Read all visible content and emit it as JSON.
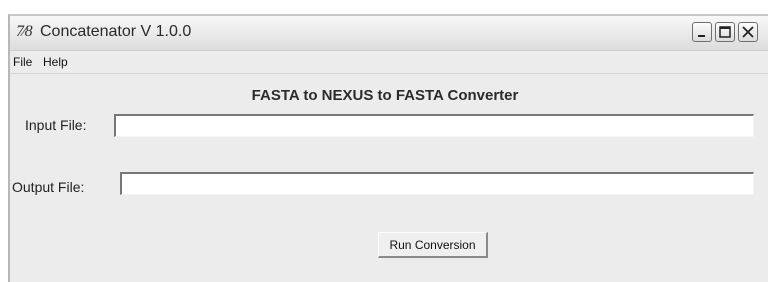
{
  "window": {
    "icon_text": "7⁄8",
    "title": "Concatenator V 1.0.0",
    "controls": [
      "minimize",
      "maximize",
      "close"
    ]
  },
  "menu": {
    "items": [
      {
        "label": "File"
      },
      {
        "label": "Help"
      }
    ]
  },
  "main": {
    "heading": "FASTA to NEXUS to FASTA Converter",
    "input": {
      "label": "Input File:",
      "value": ""
    },
    "output": {
      "label": "Output File:",
      "value": ""
    },
    "run_button_label": "Run Conversion"
  }
}
